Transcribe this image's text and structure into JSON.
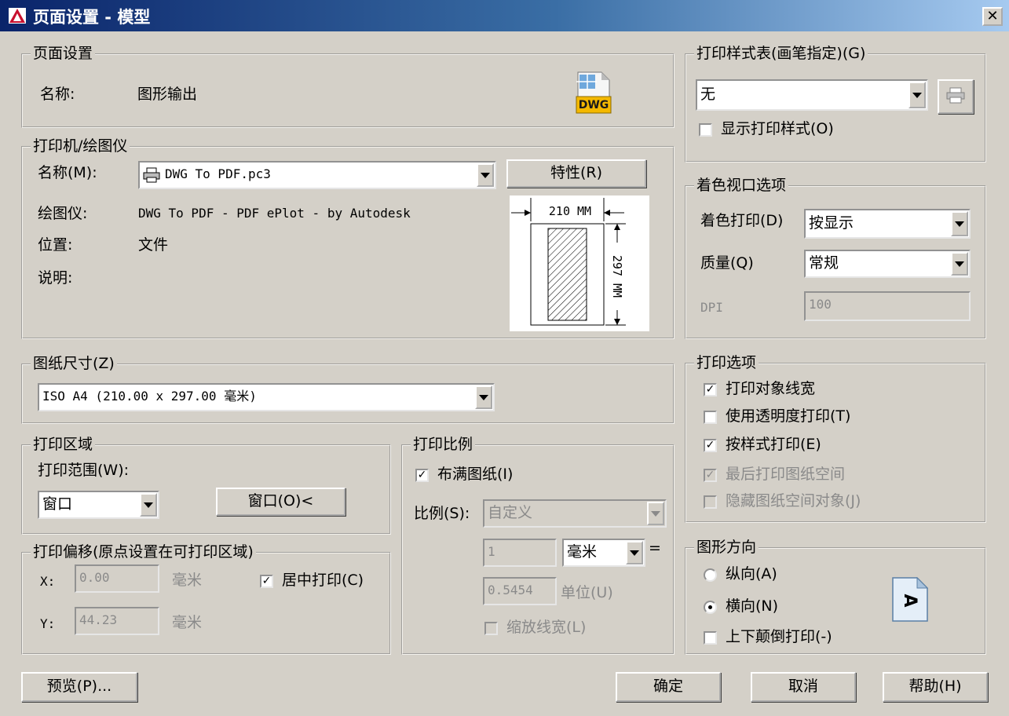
{
  "window": {
    "title": "页面设置 - 模型",
    "close_glyph": "✕"
  },
  "page_setup": {
    "label": "页面设置",
    "name_label": "名称:",
    "name_value": "图形输出",
    "icon_text": "DWG"
  },
  "printer": {
    "label": "打印机/绘图仪",
    "name_label": "名称(M):",
    "name_value": "DWG To PDF.pc3",
    "properties_button": "特性(R)",
    "plotter_label": "绘图仪:",
    "plotter_value": "DWG To PDF - PDF ePlot - by Autodesk",
    "location_label": "位置:",
    "location_value": "文件",
    "description_label": "说明:",
    "preview_width": "210 MM",
    "preview_height": "297 MM"
  },
  "paper_size": {
    "label": "图纸尺寸(Z)",
    "value": "ISO A4 (210.00 x 297.00 毫米)"
  },
  "plot_area": {
    "label": "打印区域",
    "range_label": "打印范围(W):",
    "range_value": "窗口",
    "window_button": "窗口(O)<"
  },
  "plot_offset": {
    "label": "打印偏移(原点设置在可打印区域)",
    "x_label": "X:",
    "x_value": "0.00",
    "x_unit": "毫米",
    "y_label": "Y:",
    "y_value": "44.23",
    "y_unit": "毫米",
    "center_label": "居中打印(C)",
    "center_checked": true
  },
  "plot_scale": {
    "label": "打印比例",
    "fit_label": "布满图纸(I)",
    "fit_checked": true,
    "scale_label": "比例(S):",
    "scale_value": "自定义",
    "value1": "1",
    "unit_value": "毫米",
    "equals": "=",
    "value2": "0.5454",
    "unit2_label": "单位(U)",
    "lineweights_label": "缩放线宽(L)",
    "lineweights_checked": false
  },
  "plot_style_table": {
    "label": "打印样式表(画笔指定)(G)",
    "value": "无",
    "display_label": "显示打印样式(O)",
    "display_checked": false
  },
  "shaded_viewport": {
    "label": "着色视口选项",
    "shade_label": "着色打印(D)",
    "shade_value": "按显示",
    "quality_label": "质量(Q)",
    "quality_value": "常规",
    "dpi_label": "DPI",
    "dpi_value": "100"
  },
  "plot_options": {
    "label": "打印选项",
    "items": [
      {
        "label": "打印对象线宽",
        "checked": true,
        "disabled": false
      },
      {
        "label": "使用透明度打印(T)",
        "checked": false,
        "disabled": false
      },
      {
        "label": "按样式打印(E)",
        "checked": true,
        "disabled": false
      },
      {
        "label": "最后打印图纸空间",
        "checked": true,
        "disabled": true
      },
      {
        "label": "隐藏图纸空间对象(J)",
        "checked": false,
        "disabled": true
      }
    ]
  },
  "orientation": {
    "label": "图形方向",
    "portrait_label": "纵向(A)",
    "landscape_label": "横向(N)",
    "selected": "landscape",
    "upside_down_label": "上下颠倒打印(-)",
    "upside_down_checked": false,
    "icon_glyph": "A"
  },
  "buttons": {
    "preview": "预览(P)...",
    "ok": "确定",
    "cancel": "取消",
    "help": "帮助(H)"
  },
  "colors": {
    "titlebar_start": "#0a246a",
    "titlebar_end": "#a6caf0",
    "dialog_bg": "#d4d0c8"
  }
}
